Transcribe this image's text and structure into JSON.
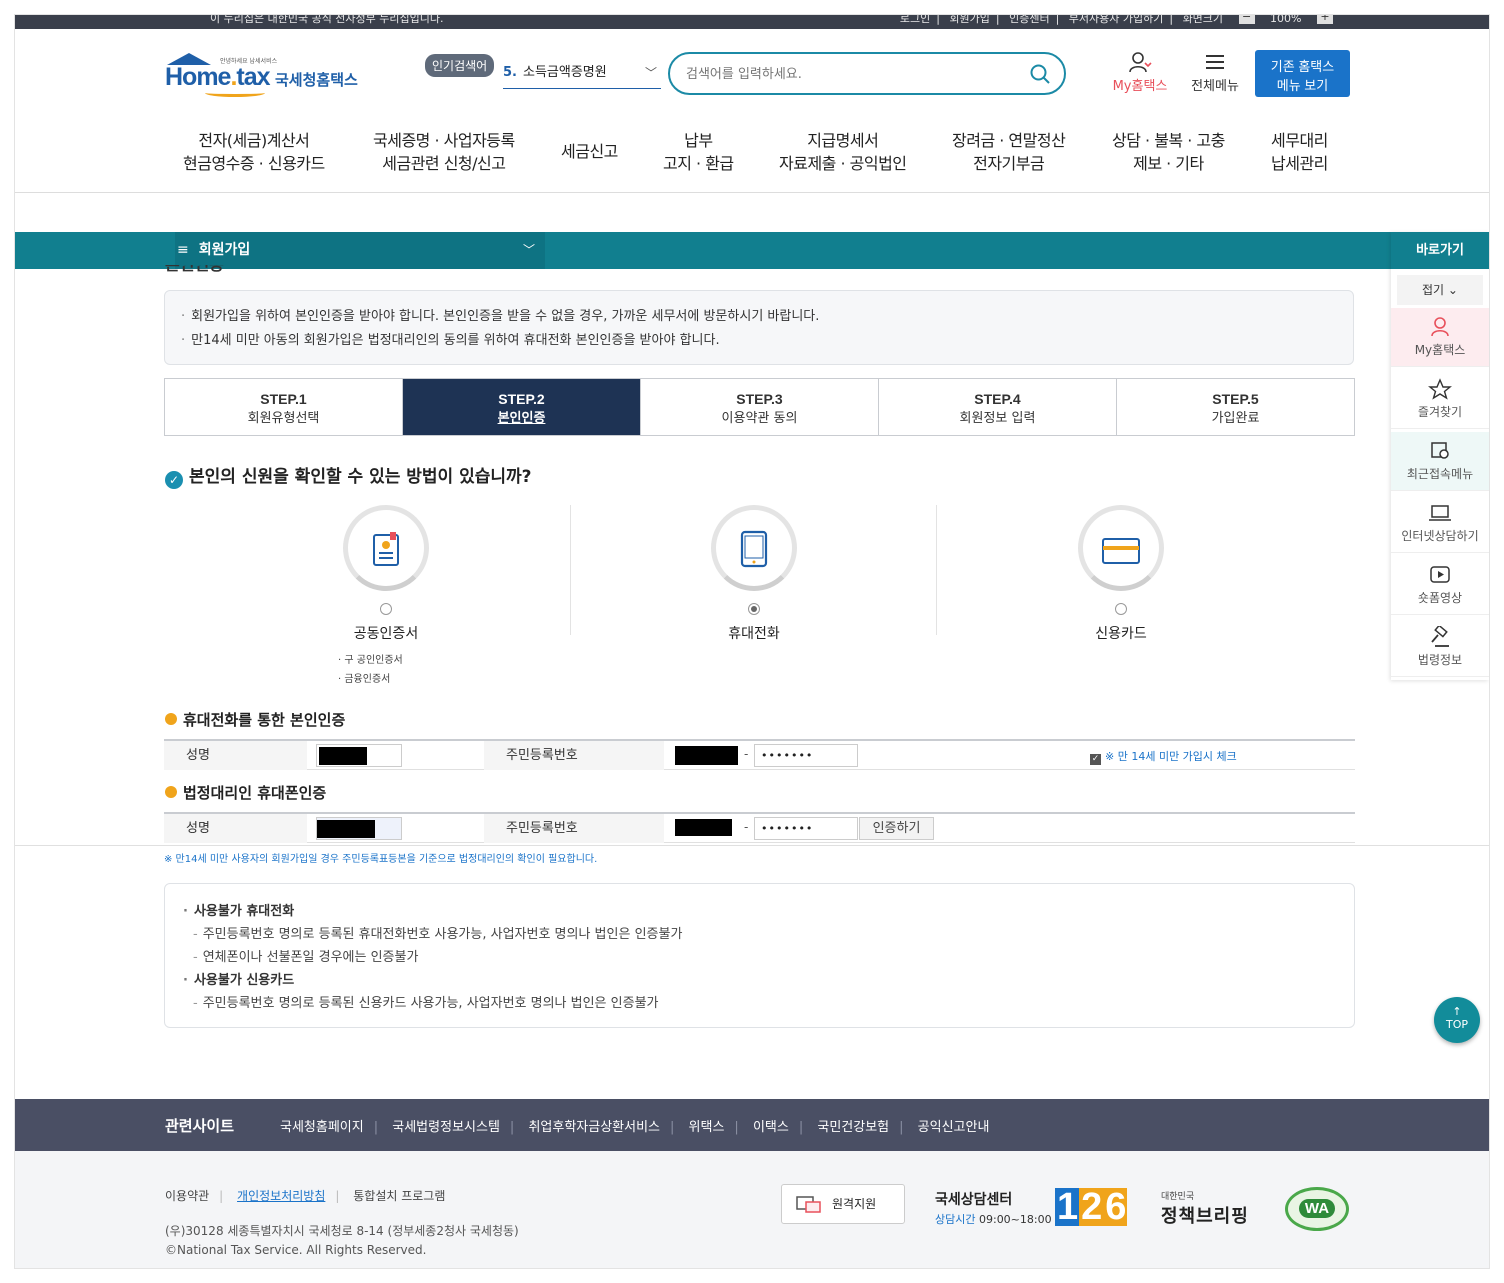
{
  "utilbar": {
    "notice": "이 누리집은 대한민국 공식 전자정부 누리집입니다.",
    "links": [
      "로그인",
      "회원가입",
      "인증센터",
      "부서사용자 가입하기",
      "화면크기"
    ],
    "zoom_minus": "−",
    "zoom": "100%",
    "zoom_plus": "+"
  },
  "header": {
    "logo_small": "안녕하세요 납세서비스",
    "logo_eng_1": "Home",
    "logo_eng_2": "tax",
    "logo_kor": "국세청홈택스",
    "popular_label": "인기검색어",
    "popular_rank": "5.",
    "popular_text": "소득금액증명원",
    "search_placeholder": "검색어를 입력하세요.",
    "my_hometax": "My홈택스",
    "all_menu": "전체메뉴",
    "legacy_1": "기존 홈택스",
    "legacy_2": "메뉴 보기"
  },
  "gnb": [
    {
      "l1": "전자(세금)계산서",
      "l2": "현금영수증 · 신용카드"
    },
    {
      "l1": "국세증명 · 사업자등록",
      "l2": "세금관련 신청/신고"
    },
    {
      "l1": "세금신고",
      "l2": ""
    },
    {
      "l1": "납부",
      "l2": "고지 · 환급"
    },
    {
      "l1": "지급명세서",
      "l2": "자료제출 · 공익법인"
    },
    {
      "l1": "장려금 · 연말정산",
      "l2": "전자기부금"
    },
    {
      "l1": "상담 · 불복 · 고충",
      "l2": "제보 · 기타"
    },
    {
      "l1": "세무대리",
      "l2": "납세관리"
    }
  ],
  "location": {
    "menu": "회원가입"
  },
  "cut_title": "본인인증",
  "info": [
    "회원가입을 위하여 본인인증을 받아야 합니다. 본인인증을 받을 수 없을 경우, 가까운 세무서에 방문하시기 바랍니다.",
    "만14세 미만 아동의 회원가입은 법정대리인의 동의를 위하여 휴대전화 본인인증을 받아야 합니다."
  ],
  "steps": [
    {
      "num": "STEP.1",
      "label": "회원유형선택"
    },
    {
      "num": "STEP.2",
      "label": "본인인증"
    },
    {
      "num": "STEP.3",
      "label": "이용약관 동의"
    },
    {
      "num": "STEP.4",
      "label": "회원정보 입력"
    },
    {
      "num": "STEP.5",
      "label": "가입완료"
    }
  ],
  "question": "본인의 신원을 확인할 수 있는 방법이 있습니까?",
  "methods": {
    "cert": {
      "label": "공동인증서",
      "sub1": "구 공인인증서",
      "sub2": "금융인증서"
    },
    "phone": {
      "label": "휴대전화"
    },
    "card": {
      "label": "신용카드"
    }
  },
  "phone_section": {
    "title": "휴대전화를 통한 본인인증",
    "name_label": "성명",
    "rrn_label": "주민등록번호",
    "rrn_back": "•••••••",
    "dash": "-",
    "under14": "※ 만 14세 미만 가입시 체크",
    "check_mark": "✓"
  },
  "guardian_section": {
    "title": "법정대리인 휴대폰인증",
    "name_label": "성명",
    "rrn_label": "주민등록번호",
    "rrn_back": "•••••••",
    "dash": "-",
    "verify": "인증하기"
  },
  "foot_note": "※ 만14세 미만 사용자의 회원가입일 경우 주민등록표등본을 기준으로 법정대리인의 확인이 필요합니다.",
  "warn": {
    "t1": "사용불가 휴대전화",
    "s1": "주민등록번호 명의로 등록된 휴대전화번호 사용가능, 사업자번호 명의나 법인은 인증불가",
    "s2": "연체폰이나 선불폰일 경우에는 인증불가",
    "t2": "사용불가 신용카드",
    "s3": "주민등록번호 명의로 등록된 신용카드 사용가능, 사업자번호 명의나 법인은 인증불가"
  },
  "quick": {
    "title": "바로가기",
    "fold": "접기",
    "items": [
      "My홈택스",
      "즐겨찾기",
      "최근접속메뉴",
      "인터넷상담하기",
      "숏폼영상",
      "법령정보"
    ]
  },
  "top_btn": {
    "arrow": "↑",
    "label": "TOP"
  },
  "related": {
    "title": "관련사이트",
    "links": [
      "국세청홈페이지",
      "국세법령정보시스템",
      "취업후학자금상환서비스",
      "위택스",
      "이택스",
      "국민건강보험",
      "공익신고안내"
    ]
  },
  "footer": {
    "links": [
      "이용약관",
      "개인정보처리방침",
      "통합설치 프로그램"
    ],
    "address": "(우)30128 세종특별자치시 국세청로 8-14 (정부세종2청사 국세청동)",
    "copyright": "©National Tax Service. All Rights Reserved.",
    "remote": "원격지원",
    "center_title": "국세상담센터",
    "center_hours_label": "상담시간",
    "center_hours": "09:00~18:00",
    "n1": "1",
    "n2": "2",
    "n3": "6",
    "brief_small": "대한민국",
    "brief_main": "정책브리핑",
    "wa": "WA"
  },
  "colors": {
    "teal": "#117f8f",
    "navy_step": "#1e3354",
    "accent_blue": "#1a73c9",
    "orange": "#f0a41b",
    "footer_band": "#4a4f64"
  }
}
